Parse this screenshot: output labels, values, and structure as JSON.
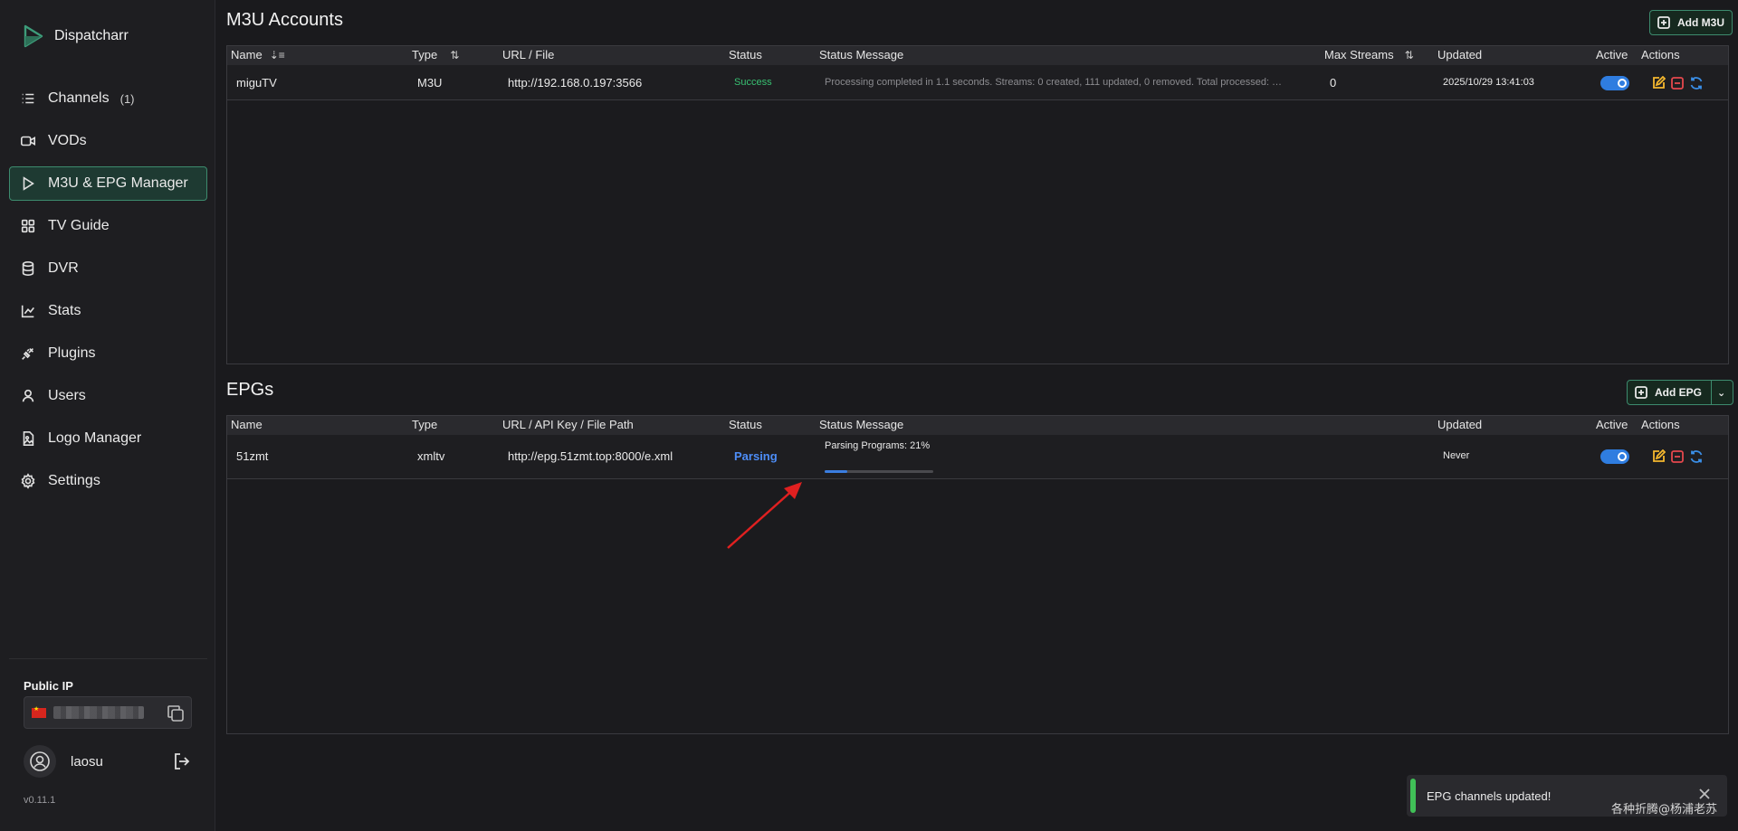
{
  "app": {
    "name": "Dispatcharr",
    "version": "v0.11.1",
    "accent": "#3d8b6e"
  },
  "sidebar": {
    "items": [
      {
        "label": "Channels",
        "icon": "list-icon",
        "badge": "(1)"
      },
      {
        "label": "VODs",
        "icon": "video-icon"
      },
      {
        "label": "M3U & EPG Manager",
        "icon": "play-icon",
        "active": true
      },
      {
        "label": "TV Guide",
        "icon": "grid-icon"
      },
      {
        "label": "DVR",
        "icon": "database-icon"
      },
      {
        "label": "Stats",
        "icon": "chart-line-icon"
      },
      {
        "label": "Plugins",
        "icon": "plug-icon"
      },
      {
        "label": "Users",
        "icon": "user-icon"
      },
      {
        "label": "Logo Manager",
        "icon": "image-file-icon"
      },
      {
        "label": "Settings",
        "icon": "gear-icon"
      }
    ],
    "public_ip_label": "Public IP",
    "username": "laosu"
  },
  "m3u": {
    "title": "M3U Accounts",
    "add_label": "Add M3U",
    "columns": [
      "Name",
      "Type",
      "URL / File",
      "Status",
      "Status Message",
      "Max Streams",
      "Updated",
      "Active",
      "Actions"
    ],
    "rows": [
      {
        "name": "miguTV",
        "type": "M3U",
        "url": "http://192.168.0.197:3566",
        "status": "Success",
        "message": "Processing completed in 1.1 seconds. Streams: 0 created, 111 updated, 0 removed. Total processed: …",
        "max_streams": "0",
        "updated": "2025/10/29 13:41:03",
        "active": true
      }
    ]
  },
  "epg": {
    "title": "EPGs",
    "add_label": "Add EPG",
    "columns": [
      "Name",
      "Type",
      "URL / API Key / File Path",
      "Status",
      "Status Message",
      "Updated",
      "Active",
      "Actions"
    ],
    "rows": [
      {
        "name": "51zmt",
        "type": "xmltv",
        "url": "http://epg.51zmt.top:8000/e.xml",
        "status": "Parsing",
        "message": "Parsing Programs: 21%",
        "progress": 0.21,
        "updated": "Never",
        "active": true
      }
    ]
  },
  "toast": {
    "message": "EPG channels updated!",
    "color": "#40c057"
  },
  "watermark": "各种折腾@杨浦老苏"
}
